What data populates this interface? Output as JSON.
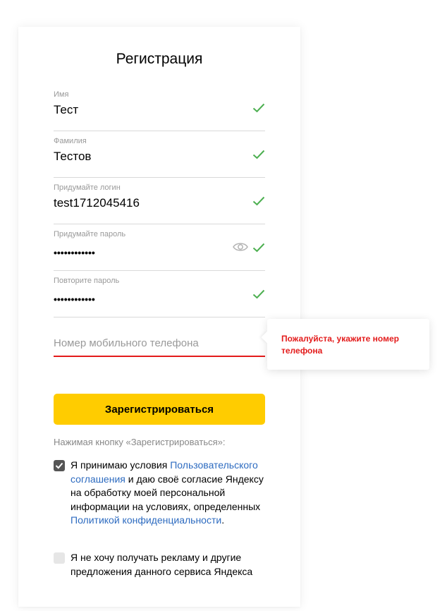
{
  "form": {
    "title": "Регистрация",
    "fields": [
      {
        "label": "Имя",
        "value": "Тест"
      },
      {
        "label": "Фамилия",
        "value": "Тестов"
      },
      {
        "label": "Придумайте логин",
        "value": "test1712045416"
      },
      {
        "label": "Придумайте пароль",
        "value": "••••••••••••"
      },
      {
        "label": "Повторите пароль",
        "value": "••••••••••••"
      }
    ],
    "phone": {
      "placeholder": "Номер мобильного телефона",
      "value": ""
    },
    "submit_label": "Зарегистрироваться",
    "hint": "Нажимая кнопку «Зарегистрироваться»:",
    "agreement": {
      "checked": true,
      "text_before": "Я принимаю условия ",
      "link1": "Пользовательского соглашения",
      "text_middle": " и даю своё согласие Яндексу на обработку моей персональной информации на условиях, определенных ",
      "link2": "Политикой конфиденциальности",
      "text_after": "."
    },
    "no_ads": {
      "checked": false,
      "text": "Я не хочу получать рекламу и другие предложения данного сервиса Яндекса"
    }
  },
  "tooltip": {
    "message": "Пожалуйста, укажите номер телефона",
    "color": "#e31b1b"
  },
  "colors": {
    "accent": "#ffcc00",
    "link": "#2d6bc0",
    "valid": "#4caf50",
    "error": "#e31b1b"
  },
  "icons": {
    "valid": "check-icon",
    "password_visibility": "eye-icon"
  }
}
